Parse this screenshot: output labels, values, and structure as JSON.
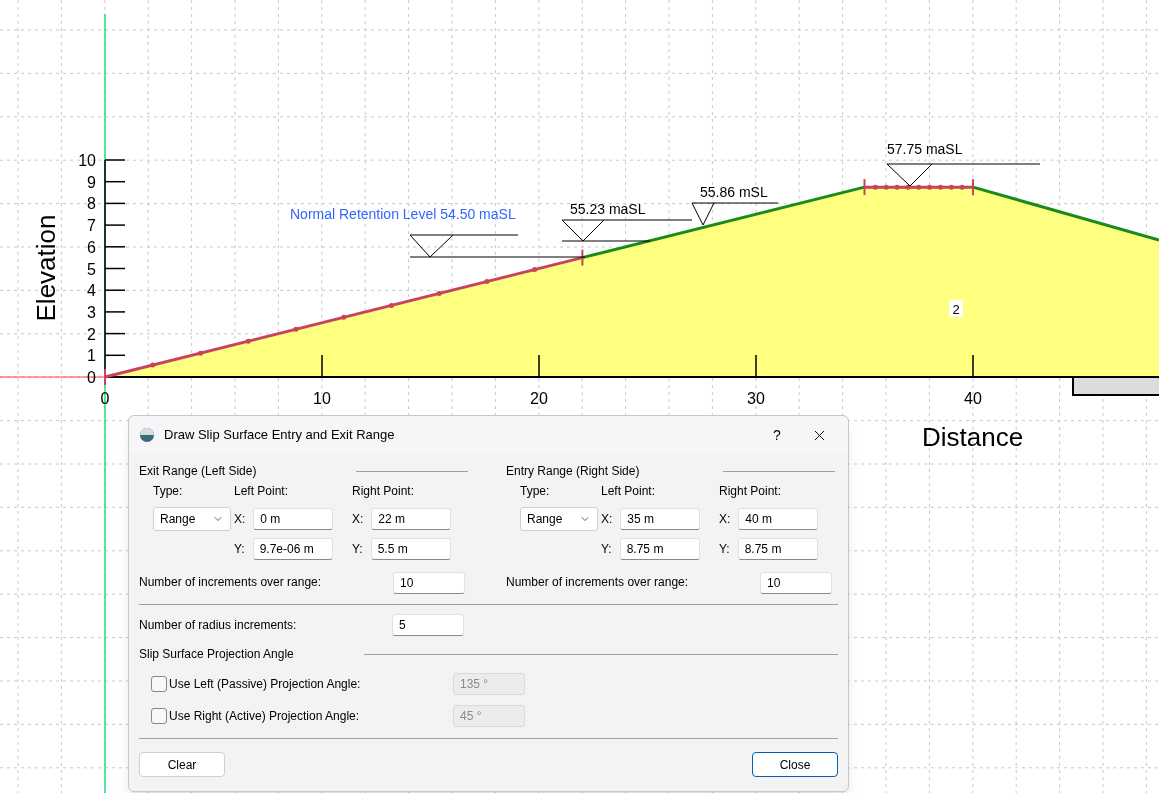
{
  "canvas": {
    "y_axis_title": "Elevation",
    "x_axis_title": "Distance",
    "y_ticks": [
      "10",
      "9",
      "8",
      "7",
      "6",
      "5",
      "4",
      "3",
      "2",
      "1",
      "0"
    ],
    "x_ticks": [
      "0",
      "10",
      "20",
      "30",
      "40"
    ],
    "water_levels": [
      {
        "label": "Normal Retention Level 54.50 maSL",
        "color": "#3366ff"
      },
      {
        "label": "55.23 maSL",
        "color": "#000000"
      },
      {
        "label": "55.86 mSL",
        "color": "#000000"
      },
      {
        "label": "57.75 maSL",
        "color": "#000000"
      }
    ],
    "material_label": "2"
  },
  "dialog": {
    "title": "Draw Slip Surface Entry and Exit Range",
    "help": "?",
    "groups": [
      {
        "heading": "Exit Range (Left Side)",
        "type_label": "Type:",
        "type_value": "Range",
        "left_label": "Left Point:",
        "right_label": "Right Point:",
        "left_x": {
          "label": "X:",
          "value": "0 m"
        },
        "left_y": {
          "label": "Y:",
          "value": "9.7e-06 m"
        },
        "right_x": {
          "label": "X:",
          "value": "22 m"
        },
        "right_y": {
          "label": "Y:",
          "value": "5.5 m"
        },
        "increments_label": "Number of increments over range:",
        "increments_value": "10"
      },
      {
        "heading": "Entry Range (Right Side)",
        "type_label": "Type:",
        "type_value": "Range",
        "left_label": "Left Point:",
        "right_label": "Right Point:",
        "left_x": {
          "label": "X:",
          "value": "35 m"
        },
        "left_y": {
          "label": "Y:",
          "value": "8.75 m"
        },
        "right_x": {
          "label": "X:",
          "value": "40 m"
        },
        "right_y": {
          "label": "Y:",
          "value": "8.75 m"
        },
        "increments_label": "Number of increments over range:",
        "increments_value": "10"
      }
    ],
    "radius_label": "Number of radius increments:",
    "radius_value": "5",
    "projection_heading": "Slip Surface Projection Angle",
    "projection_options": [
      {
        "label": "Use Left (Passive) Projection Angle:",
        "checked": false,
        "value": "135 °",
        "disabled": true
      },
      {
        "label": "Use Right (Active) Projection Angle:",
        "checked": false,
        "value": "45 °",
        "disabled": true
      }
    ],
    "buttons": [
      {
        "label": "Clear",
        "default": false
      },
      {
        "label": "Close",
        "default": true
      }
    ]
  }
}
